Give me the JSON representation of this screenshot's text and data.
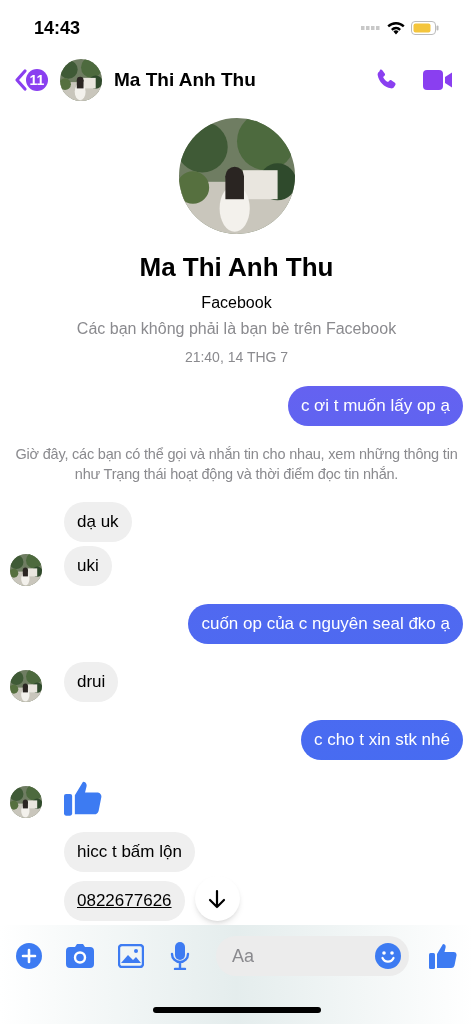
{
  "status_bar": {
    "time": "14:43"
  },
  "header": {
    "back_badge": "11",
    "name": "Ma Thi Anh Thu"
  },
  "profile": {
    "name": "Ma Thi Anh Thu",
    "source": "Facebook",
    "note": "Các bạn không phải là bạn bè trên Facebook"
  },
  "messages": [
    {
      "kind": "timestamp",
      "text": "21:40, 14 THG 7"
    },
    {
      "kind": "outgoing",
      "text": "c ơi t muốn lấy op ạ"
    },
    {
      "kind": "system",
      "text": "Giờ đây, các bạn có thể gọi và nhắn tin cho nhau, xem những thông tin như Trạng thái hoạt động và thời điểm đọc tin nhắn."
    },
    {
      "kind": "incoming",
      "text": "dạ uk",
      "avatar": false,
      "link": false
    },
    {
      "kind": "incoming",
      "text": "uki",
      "avatar": true,
      "link": false
    },
    {
      "kind": "outgoing",
      "text": "cuốn op của c nguyên seal đko ạ"
    },
    {
      "kind": "incoming",
      "text": "drui",
      "avatar": true,
      "link": false
    },
    {
      "kind": "outgoing",
      "text": "c cho t xin stk nhé"
    },
    {
      "kind": "like",
      "avatar": true
    },
    {
      "kind": "incoming",
      "text": "hicc t bấm lộn",
      "avatar": false,
      "link": false
    },
    {
      "kind": "incoming",
      "text": "0822677626",
      "avatar": false,
      "link": true
    }
  ],
  "composer": {
    "placeholder": "Aa"
  }
}
